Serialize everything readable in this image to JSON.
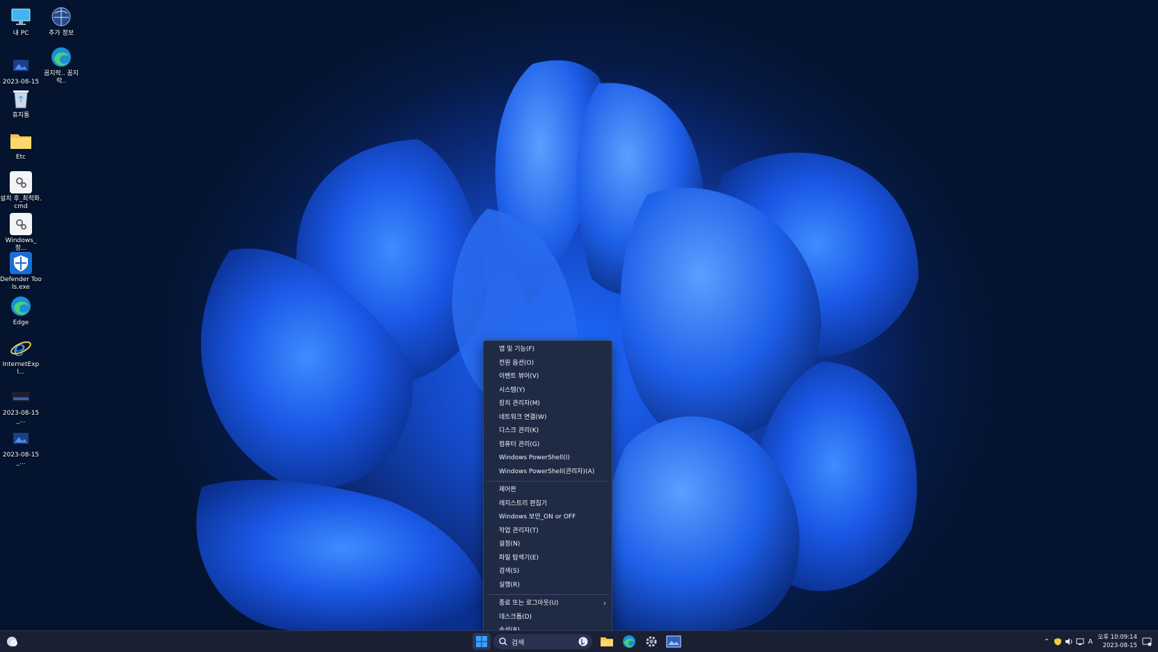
{
  "desktop": {
    "icons": [
      {
        "label": "내 PC",
        "icon": "monitor-icon"
      },
      {
        "label": "추가 정보",
        "icon": "info-globe-icon"
      },
      {
        "label": "2023-08-15_...",
        "icon": "image-file-icon"
      },
      {
        "label": "꼼지락.. 꼼지락..",
        "icon": "edge-icon"
      },
      {
        "label": "휴지통",
        "icon": "recycle-bin-icon"
      },
      {
        "label": "Etc",
        "icon": "folder-icon"
      },
      {
        "label": "설치 후_최적화.cmd",
        "icon": "cmd-gear-icon"
      },
      {
        "label": "Windows_정...",
        "icon": "cmd-gear-icon"
      },
      {
        "label": "Defender Tools.exe",
        "icon": "shield-icon"
      },
      {
        "label": "Edge",
        "icon": "edge-icon"
      },
      {
        "label": "InternetExpl...",
        "icon": "internet-explorer-icon"
      },
      {
        "label": "2023-08-15_...",
        "icon": "image-file-icon"
      },
      {
        "label": "2023-08-15_...",
        "icon": "image-file-icon"
      }
    ]
  },
  "context_menu": {
    "items": [
      "앱 및 기능(F)",
      "전원 옵션(O)",
      "이벤트 뷰어(V)",
      "시스템(Y)",
      "장치 관리자(M)",
      "네트워크 연결(W)",
      "디스크 관리(K)",
      "컴퓨터 관리(G)",
      "Windows PowerShell(I)",
      "Windows PowerShell(관리자)(A)",
      "제어판",
      "레지스트리 편집기",
      "Windows 보안_ON or OFF",
      "작업 관리자(T)",
      "설정(N)",
      "파일 탐색기(E)",
      "검색(S)",
      "실행(R)",
      "종료 또는 로그아웃(U)",
      "데스크톱(D)",
      "속성(R)"
    ]
  },
  "taskbar": {
    "search_placeholder": "검색",
    "tray_ime": "A",
    "clock_time": "오후 10:09:14",
    "clock_date": "2023-08-15",
    "colors": {
      "accent": "#1e90ff",
      "taskbar_bg": "#1a2033"
    }
  }
}
